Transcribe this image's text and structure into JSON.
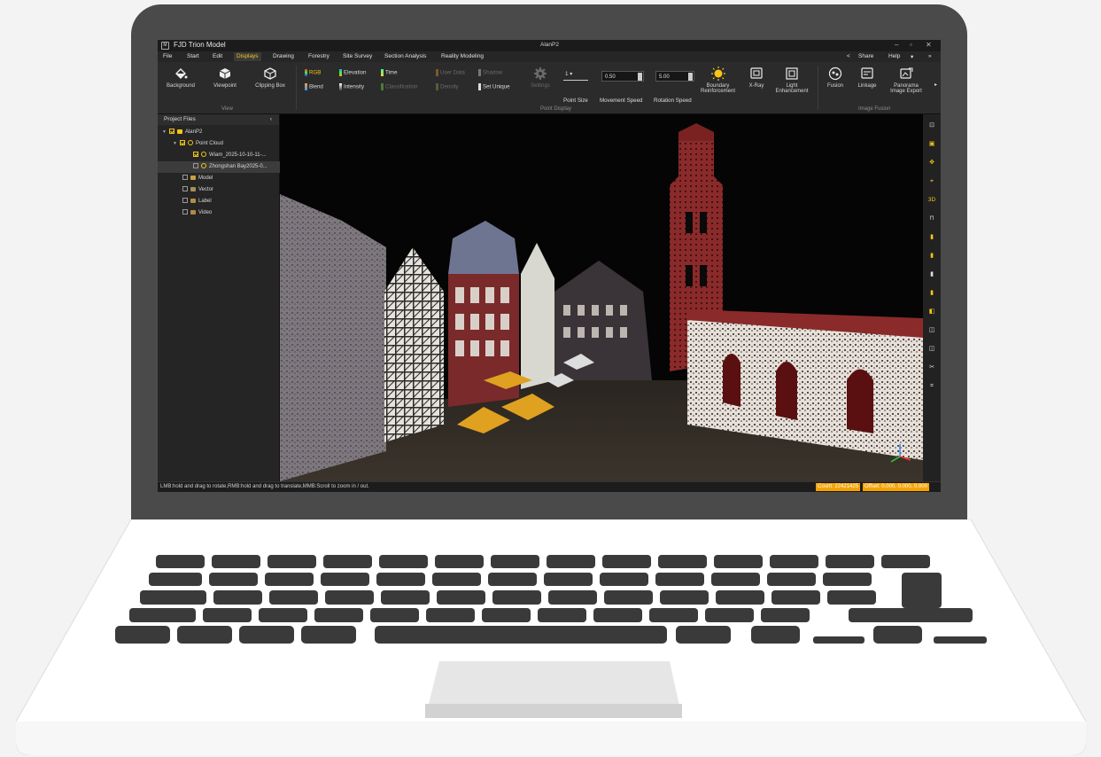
{
  "window": {
    "app_title": "FJD Trion Model",
    "doc_title": "AlanP2"
  },
  "menu": {
    "items": [
      "File",
      "Start",
      "Edit",
      "Displays",
      "Drawing",
      "Forestry",
      "Site Survey",
      "Section Analysis",
      "Reality Modeling"
    ],
    "active": "Displays",
    "share": "Share",
    "help": "Help"
  },
  "ribbon": {
    "view": {
      "label": "View",
      "background": "Background",
      "viewpoint": "Viewpoint",
      "clipping_box": "Clipping Box"
    },
    "point_display": {
      "label": "Point Display",
      "rgb": "RGB",
      "elevation": "Elevation",
      "time": "Time",
      "user_data": "User Data",
      "shadow": "Shadow",
      "blend": "Blend",
      "intensity": "Intensity",
      "classification": "Classification",
      "density": "Density",
      "set_unique": "Set Unique",
      "settings": "Settings",
      "point_size_value": "1",
      "point_size": "Point Size",
      "movement_speed_value": "0.50",
      "movement_speed": "Movement Speed",
      "rotation_speed_value": "5.00",
      "rotation_speed": "Rotation Speed",
      "boundary_1": "Boundary",
      "boundary_2": "Reinforcement",
      "xray": "X-Ray",
      "light_1": "Light",
      "light_2": "Enhancement"
    },
    "image_fusion": {
      "label": "Image Fusion",
      "fusion": "Fusion",
      "linkage": "Linkage",
      "panorama_1": "Panorama",
      "panorama_2": "Image Export"
    }
  },
  "panel": {
    "title": "Project Files",
    "tree": {
      "root": "AlanP2",
      "point_cloud": "Point Cloud",
      "file1": "Wiam_2025-10-10-11-...",
      "file2": "Zhongshan Bay2025-0...",
      "model": "Model",
      "vector": "Vector",
      "label": "Label",
      "video": "Video"
    }
  },
  "right_tools": {
    "threed": "3D"
  },
  "status": {
    "hint": "LMB:hold and drag to rotate,RMB:hold and drag to translate,MMB:Scroll to zoom in / out.",
    "count": "Count: 22421425",
    "offset": "Offset: 0.000, 0.000, 0.000"
  },
  "colors": {
    "accent": "#f5c518",
    "status_badge": "#f5a300",
    "loaded_dot": "#3ddc3d"
  }
}
